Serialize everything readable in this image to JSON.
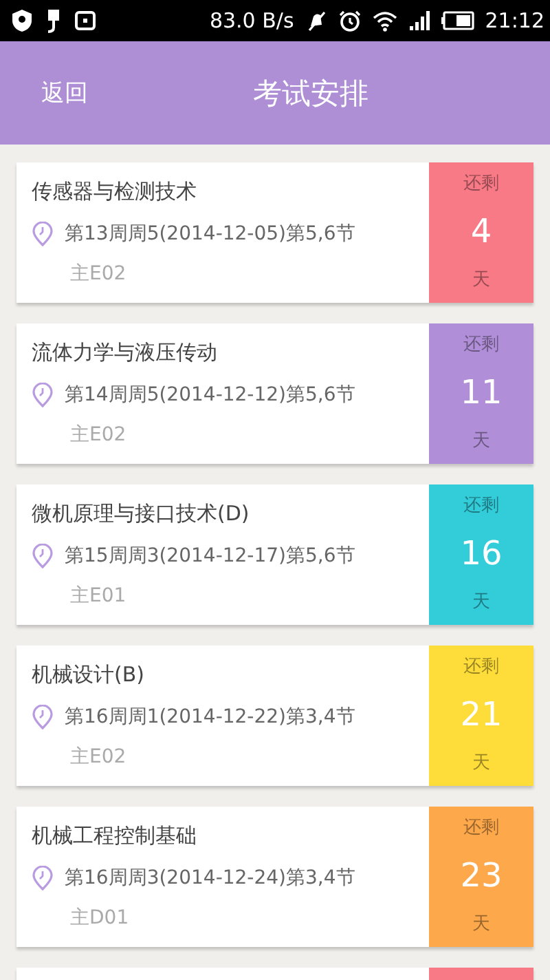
{
  "status_bar": {
    "speed": "83.0 B/s",
    "time": "21:12"
  },
  "header": {
    "back": "返回",
    "title": "考试安排"
  },
  "exams": [
    {
      "course": "传感器与检测技术",
      "time": "第13周周5(2014-12-05)第5,6节",
      "room": "主E02",
      "remain_label": "还剩",
      "days": "4",
      "unit": "天",
      "color": "#f87a86"
    },
    {
      "course": "流体力学与液压传动",
      "time": "第14周周5(2014-12-12)第5,6节",
      "room": "主E02",
      "remain_label": "还剩",
      "days": "11",
      "unit": "天",
      "color": "#b08fd8"
    },
    {
      "course": "微机原理与接口技术(D)",
      "time": "第15周周3(2014-12-17)第5,6节",
      "room": "主E01",
      "remain_label": "还剩",
      "days": "16",
      "unit": "天",
      "color": "#33ccd9"
    },
    {
      "course": "机械设计(B)",
      "time": "第16周周1(2014-12-22)第3,4节",
      "room": "主E02",
      "remain_label": "还剩",
      "days": "21",
      "unit": "天",
      "color": "#fedd3a"
    },
    {
      "course": "机械工程控制基础",
      "time": "第16周周3(2014-12-24)第3,4节",
      "room": "主D01",
      "remain_label": "还剩",
      "days": "23",
      "unit": "天",
      "color": "#fea84c"
    },
    {
      "color": "#f87a86"
    }
  ]
}
